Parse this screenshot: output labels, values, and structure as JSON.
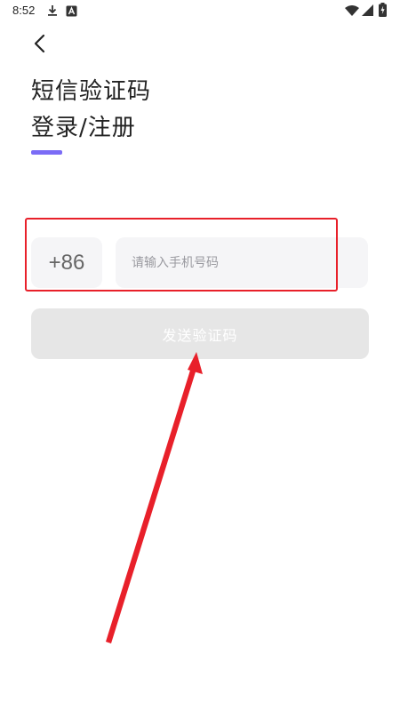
{
  "status_bar": {
    "time": "8:52",
    "icons": [
      "download-icon",
      "android-a-icon",
      "wifi-icon",
      "signal-icon",
      "battery-icon"
    ]
  },
  "colors": {
    "accent": "#7b6cf6",
    "annotation": "#e8202a",
    "input_bg": "#f5f5f7",
    "button_disabled_bg": "#e6e6e6"
  },
  "header": {
    "back_icon": "chevron-left-icon",
    "title_line1": "短信验证码",
    "title_line2": "登录/注册"
  },
  "form": {
    "country_code": "+86",
    "phone_placeholder": "请输入手机号码",
    "phone_value": "",
    "send_button_label": "发送验证码"
  }
}
